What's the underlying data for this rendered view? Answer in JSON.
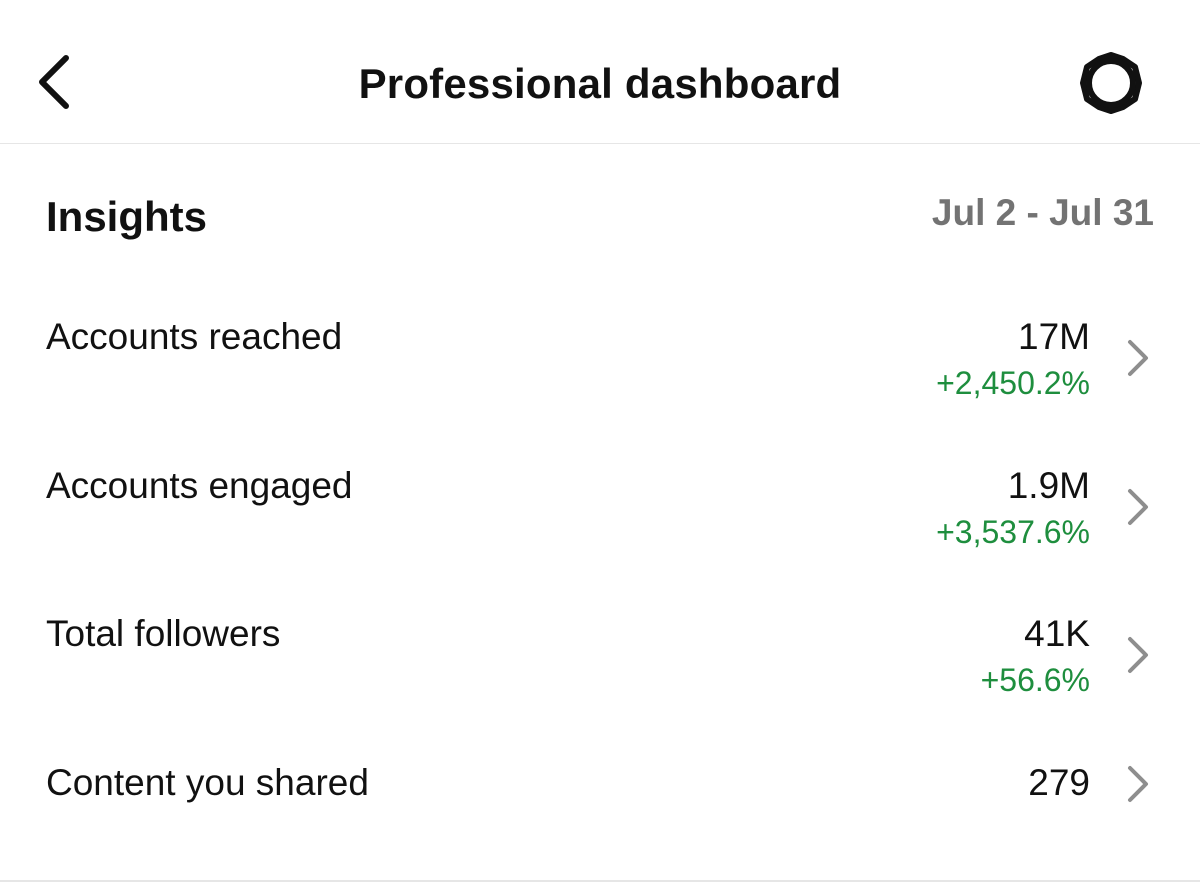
{
  "header": {
    "title": "Professional dashboard",
    "back_icon": "chevron-left-icon",
    "settings_icon": "gear-icon"
  },
  "insights": {
    "title": "Insights",
    "date_range": "Jul 2 - Jul 31",
    "metrics": [
      {
        "label": "Accounts reached",
        "value": "17M",
        "change": "+2,450.2%"
      },
      {
        "label": "Accounts engaged",
        "value": "1.9M",
        "change": "+3,537.6%"
      },
      {
        "label": "Total followers",
        "value": "41K",
        "change": "+56.6%"
      },
      {
        "label": "Content you shared",
        "value": "279",
        "change": ""
      }
    ]
  },
  "colors": {
    "positive_change": "#1e8e3e",
    "muted_text": "#737373",
    "chevron": "#8e8e8e"
  }
}
